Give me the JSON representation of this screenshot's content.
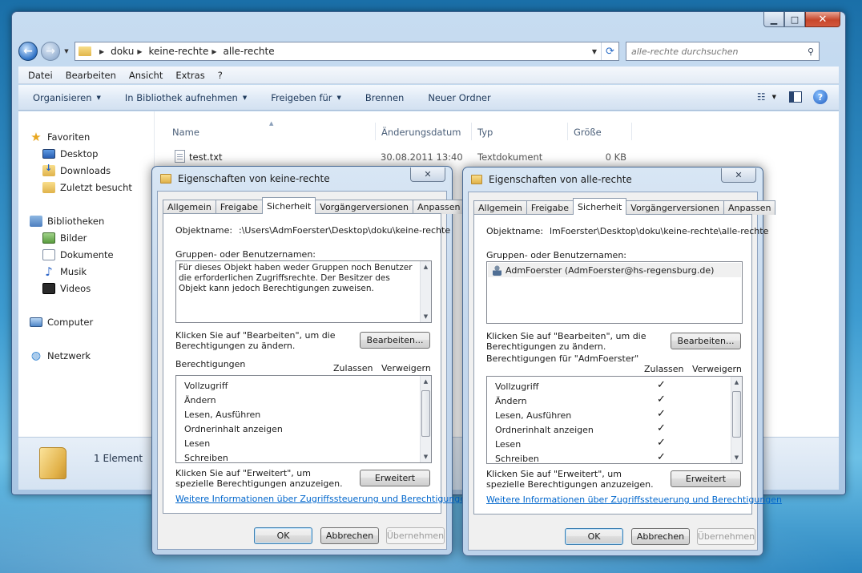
{
  "explorer": {
    "breadcrumb": [
      "doku",
      "keine-rechte",
      "alle-rechte"
    ],
    "search_placeholder": "alle-rechte durchsuchen",
    "menu": [
      "Datei",
      "Bearbeiten",
      "Ansicht",
      "Extras",
      "?"
    ],
    "commands": [
      "Organisieren",
      "In Bibliothek aufnehmen",
      "Freigeben für",
      "Brennen",
      "Neuer Ordner"
    ],
    "nav": {
      "favorites": "Favoriten",
      "desktop": "Desktop",
      "downloads": "Downloads",
      "recent": "Zuletzt besucht",
      "libraries": "Bibliotheken",
      "pictures": "Bilder",
      "documents": "Dokumente",
      "music": "Musik",
      "videos": "Videos",
      "computer": "Computer",
      "network": "Netzwerk"
    },
    "columns": {
      "name": "Name",
      "date": "Änderungsdatum",
      "type": "Typ",
      "size": "Größe"
    },
    "file": {
      "name": "test.txt",
      "date": "30.08.2011 13:40",
      "type": "Textdokument",
      "size": "0 KB"
    },
    "status": "1 Element"
  },
  "dialog1": {
    "title": "Eigenschaften von keine-rechte",
    "tabs": [
      "Allgemein",
      "Freigabe",
      "Sicherheit",
      "Vorgängerversionen",
      "Anpassen"
    ],
    "object_label": "Objektname:",
    "object_value": ":\\Users\\AdmFoerster\\Desktop\\doku\\keine-rechte",
    "groups_label": "Gruppen- oder Benutzernamen:",
    "groups_message": "Für dieses Objekt haben weder Gruppen noch Benutzer die erforderlichen Zugriffsrechte. Der Besitzer des Objekt kann jedoch Berechtigungen zuweisen.",
    "edit_hint": "Klicken Sie auf \"Bearbeiten\", um die Berechtigungen zu ändern.",
    "edit_button": "Bearbeiten...",
    "perms_label": "Berechtigungen",
    "allow": "Zulassen",
    "deny": "Verweigern",
    "perms": [
      "Vollzugriff",
      "Ändern",
      "Lesen, Ausführen",
      "Ordnerinhalt anzeigen",
      "Lesen",
      "Schreiben"
    ],
    "advanced_hint": "Klicken Sie auf \"Erweitert\", um spezielle Berechtigungen anzuzeigen.",
    "advanced_button": "Erweitert",
    "link": "Weitere Informationen über Zugriffssteuerung und Berechtigungen",
    "ok": "OK",
    "cancel": "Abbrechen",
    "apply": "Übernehmen"
  },
  "dialog2": {
    "title": "Eigenschaften von alle-rechte",
    "tabs": [
      "Allgemein",
      "Freigabe",
      "Sicherheit",
      "Vorgängerversionen",
      "Anpassen"
    ],
    "object_label": "Objektname:",
    "object_value": "lmFoerster\\Desktop\\doku\\keine-rechte\\alle-rechte",
    "groups_label": "Gruppen- oder Benutzernamen:",
    "user": "AdmFoerster (AdmFoerster@hs-regensburg.de)",
    "edit_hint": "Klicken Sie auf \"Bearbeiten\", um die Berechtigungen zu ändern.",
    "edit_button": "Bearbeiten...",
    "perms_label": "Berechtigungen für \"AdmFoerster\"",
    "allow": "Zulassen",
    "deny": "Verweigern",
    "perms": [
      "Vollzugriff",
      "Ändern",
      "Lesen, Ausführen",
      "Ordnerinhalt anzeigen",
      "Lesen",
      "Schreiben"
    ],
    "allowed_mark": "✓",
    "advanced_hint": "Klicken Sie auf \"Erweitert\", um spezielle Berechtigungen anzuzeigen.",
    "advanced_button": "Erweitert",
    "link": "Weitere Informationen über Zugriffssteuerung und Berechtigungen",
    "ok": "OK",
    "cancel": "Abbrechen",
    "apply": "Übernehmen"
  }
}
